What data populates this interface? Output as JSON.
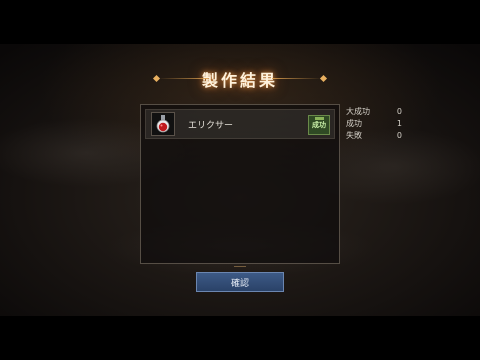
{
  "dialog": {
    "title": "製作結果"
  },
  "result_list": [
    {
      "item_name": "エリクサー",
      "item_icon": "red-potion-bottle-icon",
      "status": "成功",
      "status_color": "#2f4a24"
    }
  ],
  "stats": [
    {
      "label": "大成功",
      "value": "0"
    },
    {
      "label": "成功",
      "value": "1"
    },
    {
      "label": "失敗",
      "value": "0"
    }
  ],
  "confirm_label": "確認",
  "colors": {
    "button": "#34507a",
    "title_glow": "#f0963c"
  }
}
